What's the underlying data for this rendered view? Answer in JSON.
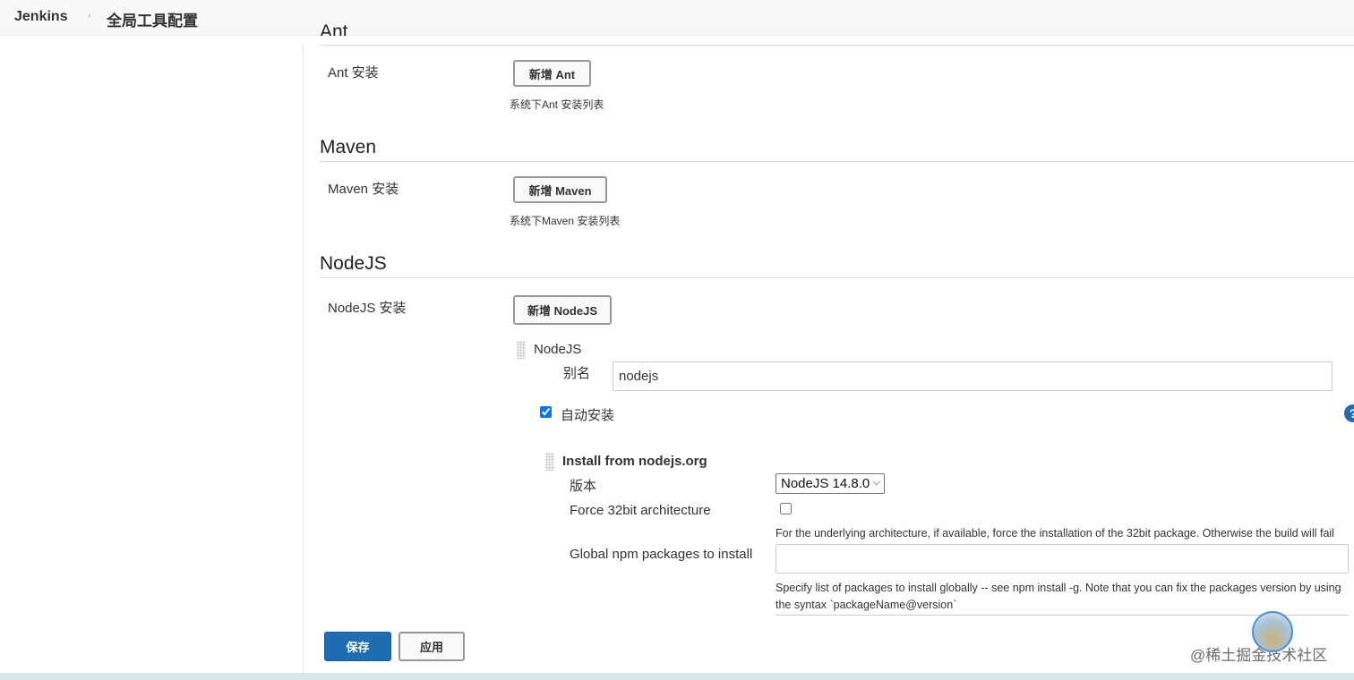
{
  "header": {
    "brand": "Jenkins",
    "separator": "›",
    "breadcrumb": "全局工具配置"
  },
  "ant": {
    "title": "Ant",
    "row_label": "Ant 安装",
    "add_button": "新增 Ant",
    "hint": "系统下Ant 安装列表"
  },
  "maven": {
    "title": "Maven",
    "row_label": "Maven 安装",
    "add_button": "新增 Maven",
    "hint": "系统下Maven 安装列表"
  },
  "nodejs": {
    "title": "NodeJS",
    "row_label": "NodeJS 安装",
    "add_button": "新增 NodeJS",
    "installation": {
      "header": "NodeJS",
      "alias_label": "别名",
      "alias_value": "nodejs",
      "auto_install_label": "自动安装",
      "auto_install_checked": true,
      "installer": {
        "title": "Install from nodejs.org",
        "version_label": "版本",
        "version_value": "NodeJS 14.8.0",
        "force32_label": "Force 32bit architecture",
        "force32_checked": false,
        "force32_help": "For the underlying architecture, if available, force the installation of the 32bit package. Otherwise the build will fail",
        "npm_label": "Global npm packages to install",
        "npm_value": "",
        "npm_help_line1": "Specify list of packages to install globally -- see npm install -g. Note that you can fix the packages version by using",
        "npm_help_line2": "the syntax `packageName@version`"
      }
    }
  },
  "footer": {
    "save": "保存",
    "apply": "应用"
  },
  "help_icon": "?",
  "watermark": "@稀土掘金技术社区",
  "colors": {
    "primary": "#1f6db0",
    "topbar_bg": "#f8f8f8",
    "bottom_bar": "#d9e6ea"
  }
}
